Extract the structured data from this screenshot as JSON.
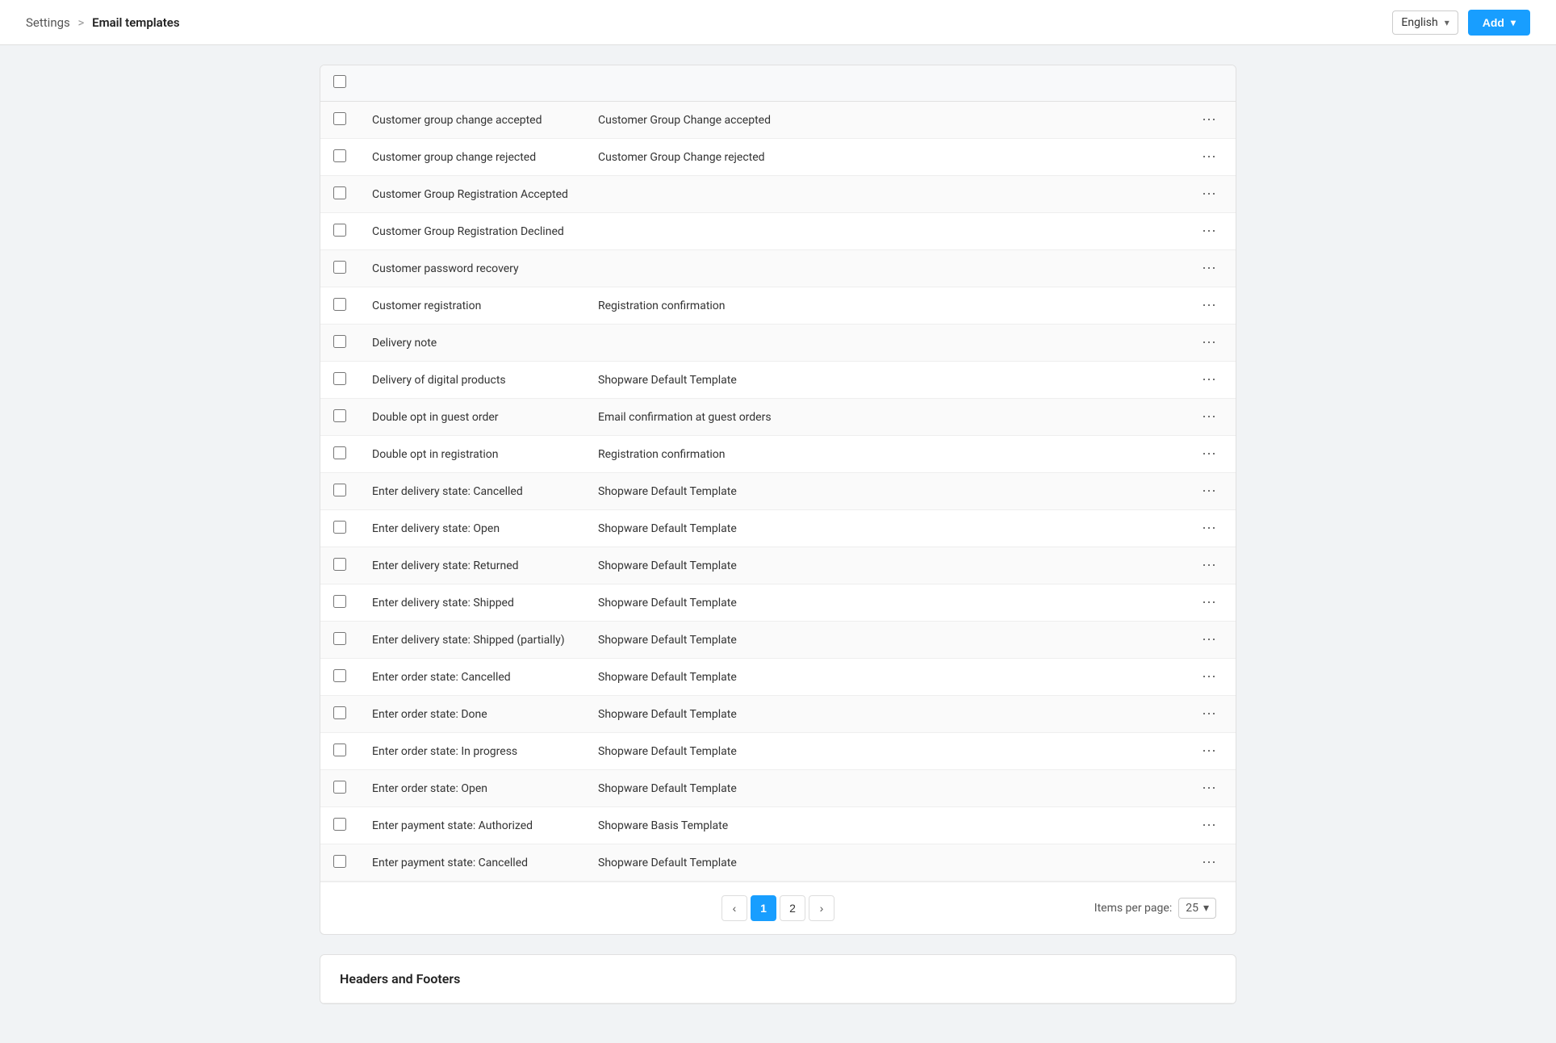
{
  "header": {
    "breadcrumb_settings": "Settings",
    "breadcrumb_separator": ">",
    "breadcrumb_current": "Email templates",
    "language_label": "English",
    "add_button_label": "Add"
  },
  "table": {
    "rows": [
      {
        "id": 1,
        "name": "Customer group change accepted",
        "template": "Customer Group Change accepted",
        "checked": false
      },
      {
        "id": 2,
        "name": "Customer group change rejected",
        "template": "Customer Group Change rejected",
        "checked": false
      },
      {
        "id": 3,
        "name": "Customer Group Registration Accepted",
        "template": "",
        "checked": false
      },
      {
        "id": 4,
        "name": "Customer Group Registration Declined",
        "template": "",
        "checked": false
      },
      {
        "id": 5,
        "name": "Customer password recovery",
        "template": "",
        "checked": false
      },
      {
        "id": 6,
        "name": "Customer registration",
        "template": "Registration confirmation",
        "checked": false
      },
      {
        "id": 7,
        "name": "Delivery note",
        "template": "",
        "checked": false
      },
      {
        "id": 8,
        "name": "Delivery of digital products",
        "template": "Shopware Default Template",
        "checked": false
      },
      {
        "id": 9,
        "name": "Double opt in guest order",
        "template": "Email confirmation at guest orders",
        "checked": false
      },
      {
        "id": 10,
        "name": "Double opt in registration",
        "template": "Registration confirmation",
        "checked": false
      },
      {
        "id": 11,
        "name": "Enter delivery state: Cancelled",
        "template": "Shopware Default Template",
        "checked": false
      },
      {
        "id": 12,
        "name": "Enter delivery state: Open",
        "template": "Shopware Default Template",
        "checked": false
      },
      {
        "id": 13,
        "name": "Enter delivery state: Returned",
        "template": "Shopware Default Template",
        "checked": false
      },
      {
        "id": 14,
        "name": "Enter delivery state: Shipped",
        "template": "Shopware Default Template",
        "checked": false
      },
      {
        "id": 15,
        "name": "Enter delivery state: Shipped (partially)",
        "template": "Shopware Default Template",
        "checked": false
      },
      {
        "id": 16,
        "name": "Enter order state: Cancelled",
        "template": "Shopware Default Template",
        "checked": false
      },
      {
        "id": 17,
        "name": "Enter order state: Done",
        "template": "Shopware Default Template",
        "checked": false
      },
      {
        "id": 18,
        "name": "Enter order state: In progress",
        "template": "Shopware Default Template",
        "checked": false
      },
      {
        "id": 19,
        "name": "Enter order state: Open",
        "template": "Shopware Default Template",
        "checked": false
      },
      {
        "id": 20,
        "name": "Enter payment state: Authorized",
        "template": "Shopware Basis Template",
        "checked": false
      },
      {
        "id": 21,
        "name": "Enter payment state: Cancelled",
        "template": "Shopware Default Template",
        "checked": false
      }
    ]
  },
  "pagination": {
    "current_page": 1,
    "pages": [
      1,
      2
    ],
    "items_per_page_label": "Items per page:",
    "items_per_page_value": "25"
  },
  "headers_footer_section": {
    "title": "Headers and Footers"
  }
}
